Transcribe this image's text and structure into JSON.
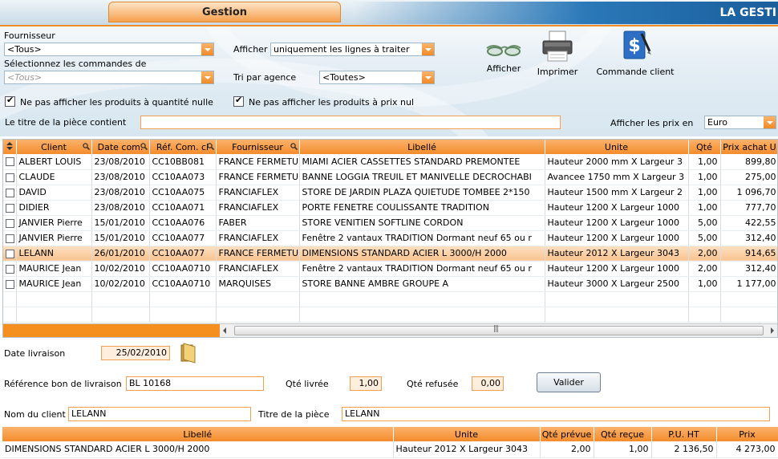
{
  "header": {
    "tab_label": "Gestion",
    "brand": "LA GESTI"
  },
  "filters": {
    "fournisseur_label": "Fournisseur",
    "fournisseur_value": "<Tous>",
    "commandes_label": "Sélectionnez les commandes de",
    "commandes_value": "<Tous>",
    "afficher_label": "Afficher",
    "afficher_value": "uniquement les lignes à traiter",
    "tri_label": "Tri par agence",
    "tri_value": "<Toutes>",
    "chk_quantite_label": "Ne pas afficher les produits à quantité nulle",
    "chk_prix_label": "Ne pas afficher les produits à prix nul",
    "titre_label": "Le titre de la pièce contient",
    "titre_value": "",
    "prix_en_label": "Afficher les prix en",
    "prix_en_value": "Euro"
  },
  "toolbar": {
    "afficher": "Afficher",
    "imprimer": "Imprimer",
    "commande_client": "Commande client"
  },
  "grid": {
    "columns": [
      "Client",
      "Date com.",
      "Réf. Com. cl",
      "Fournisseur",
      "Libellé",
      "Unite",
      "Qté",
      "Prix achat U"
    ],
    "rows": [
      [
        "ALBERT LOUIS",
        "23/08/2010",
        "CC10BB081",
        "FRANCE FERMETU",
        "MIAMI ACIER CASSETTES STANDARD PREMONTEE",
        "Hauteur 2000 mm X Largeur 3",
        "1,00",
        "899,80"
      ],
      [
        "CLAUDE",
        "23/08/2010",
        "CC10AA073",
        "FRANCE FERMETU",
        "BANNE LOGGIA TREUIL ET MANIVELLE DECROCHABI",
        "Avancee 1750 mm X Largeur 3",
        "1,00",
        "275,00"
      ],
      [
        "DAVID",
        "23/08/2010",
        "CC10AA075",
        "FRANCIAFLEX",
        "STORE DE JARDIN PLAZA QUIETUDE TOMBEE 2*150",
        "Hauteur 1500 mm X Largeur 2",
        "1,00",
        "1 096,70"
      ],
      [
        "DIDIER",
        "23/08/2010",
        "CC10AA071",
        "FRANCIAFLEX",
        "PORTE FENETRE COULISSANTE TRADITION",
        "Hauteur 1200 X Largeur 1000",
        "1,00",
        "777,70"
      ],
      [
        "JANVIER Pierre",
        "15/01/2010",
        "CC10AA076",
        "FABER",
        "STORE VENITIEN SOFTLINE CORDON",
        "Hauteur 1200 X Largeur 1000",
        "5,00",
        "422,55"
      ],
      [
        "JANVIER Pierre",
        "15/01/2010",
        "CC10AA077",
        "FRANCIAFLEX",
        "Fenêtre 2 vantaux TRADITION Dormant neuf 65 ou r",
        "Hauteur 1200 X Largeur 1000",
        "5,00",
        "312,40"
      ],
      [
        "LELANN",
        "26/01/2010",
        "CC10AA077",
        "FRANCE FERMETU",
        "DIMENSIONS STANDARD ACIER L 3000/H 2000",
        "Hauteur 2012 X Largeur 3043",
        "2,00",
        "914,65"
      ],
      [
        "MAURICE Jean",
        "10/02/2010",
        "CC10AA0710",
        "FRANCIAFLEX",
        "Fenêtre 2 vantaux TRADITION Dormant neuf 65 ou r",
        "Hauteur 1200 X Largeur 1000",
        "2,00",
        "312,40"
      ],
      [
        "MAURICE Jean",
        "10/02/2010",
        "CC10AA0710",
        "MARQUISES",
        "STORE BANNE AMBRE GROUPE A",
        "Hauteur 3000 X Largeur 2500",
        "1,00",
        "1 177,00"
      ]
    ]
  },
  "form": {
    "date_label": "Date livraison",
    "date_value": "25/02/2010",
    "ref_label": "Référence bon de livraison",
    "ref_value": "BL 10168",
    "qte_livree_label": "Qté livrée",
    "qte_livree_value": "1,00",
    "qte_refusee_label": "Qté refusée",
    "qte_refusee_value": "0,00",
    "valider": "Valider",
    "client_label": "Nom du client",
    "client_value": "LELANN",
    "titre_label": "Titre de la pièce",
    "titre_value": "LELANN"
  },
  "detail": {
    "columns": [
      "Libellé",
      "Unite",
      "Qté prévue",
      "Qté reçue",
      "P.U. HT",
      "Prix"
    ],
    "rows": [
      [
        "DIMENSIONS STANDARD ACIER L 3000/H 2000",
        "Hauteur 2012 X Largeur 3043",
        "2,00",
        "1,00",
        "2 136,50",
        "4 273,00"
      ]
    ]
  }
}
